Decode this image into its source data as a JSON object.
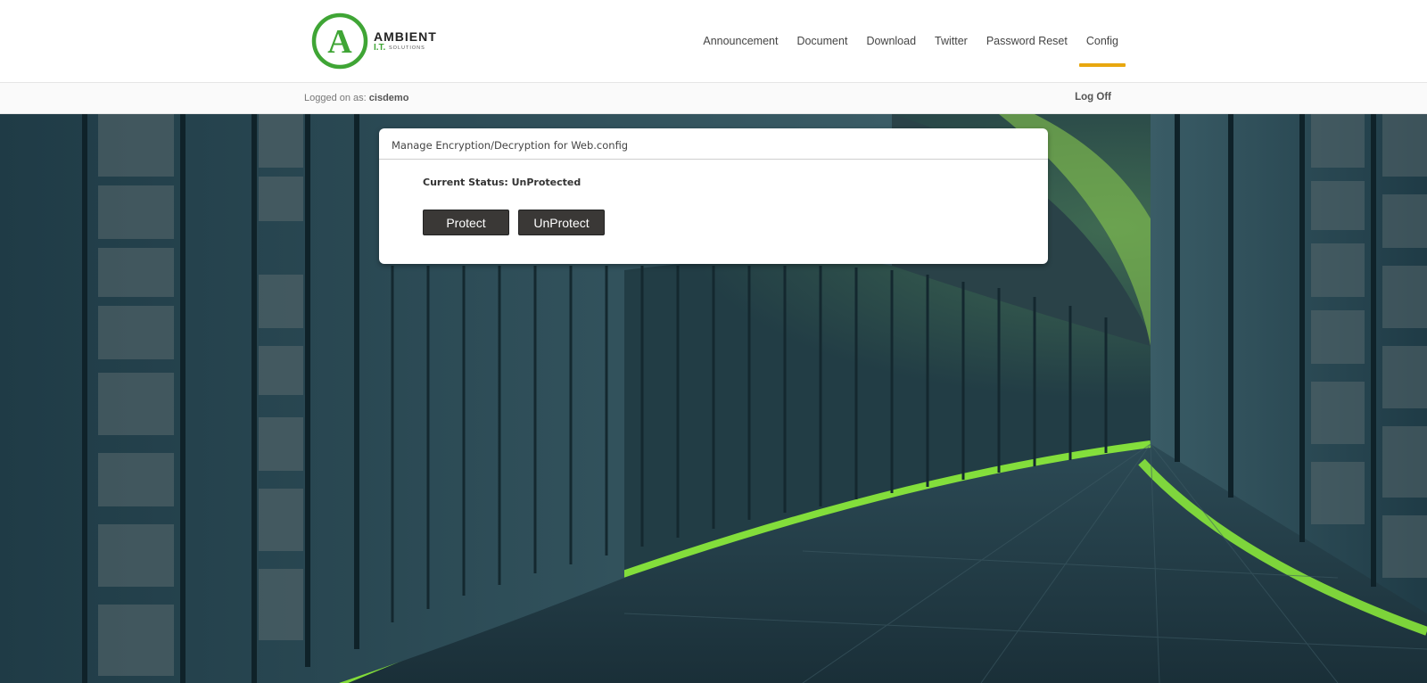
{
  "logo": {
    "letter": "A",
    "brand": "AMBIENT",
    "sub_it": "I.T.",
    "sub_solutions": "SOLUTIONS"
  },
  "nav": {
    "items": [
      {
        "label": "Announcement"
      },
      {
        "label": "Document"
      },
      {
        "label": "Download"
      },
      {
        "label": "Twitter"
      },
      {
        "label": "Password Reset"
      },
      {
        "label": "Config",
        "active": true
      }
    ]
  },
  "session": {
    "logged_prefix": "Logged on as:",
    "user": "cisdemo",
    "logoff_label": "Log Off"
  },
  "card": {
    "title": "Manage Encryption/Decryption for Web.config",
    "status_text": "Current Status: UnProtected",
    "protect_label": "Protect",
    "unprotect_label": "UnProtect"
  },
  "colors": {
    "accent": "#e8a70f",
    "brand_green": "#3fa535",
    "button_bg": "#3a3836"
  }
}
